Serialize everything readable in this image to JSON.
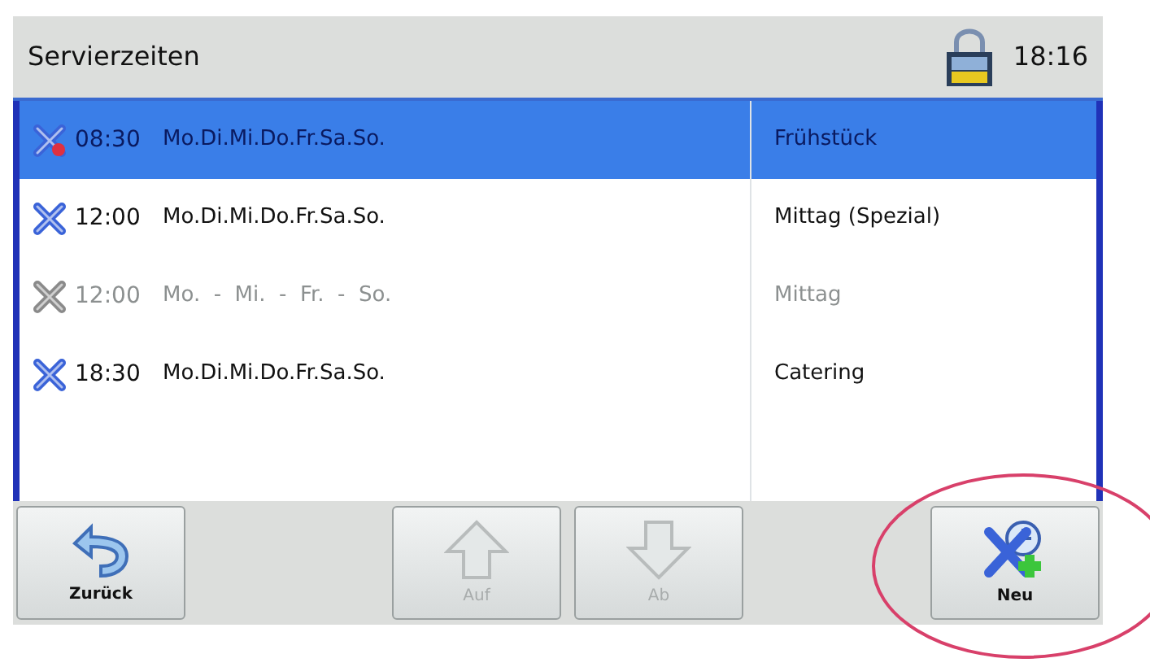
{
  "header": {
    "title": "Servierzeiten",
    "time": "18:16"
  },
  "rows": [
    {
      "time": "08:30",
      "days": "Mo.Di.Mi.Do.Fr.Sa.So.",
      "name": "Frühstück",
      "selected": true,
      "disabled": false,
      "flagged": true
    },
    {
      "time": "12:00",
      "days": "Mo.Di.Mi.Do.Fr.Sa.So.",
      "name": "Mittag (Spezial)",
      "selected": false,
      "disabled": false,
      "flagged": false
    },
    {
      "time": "12:00",
      "days": "Mo.  -  Mi.  -  Fr.  -  So.",
      "name": "Mittag",
      "selected": false,
      "disabled": true,
      "flagged": false
    },
    {
      "time": "18:30",
      "days": "Mo.Di.Mi.Do.Fr.Sa.So.",
      "name": "Catering",
      "selected": false,
      "disabled": false,
      "flagged": false
    }
  ],
  "buttons": [
    {
      "kind": "back",
      "label": "Zurück",
      "disabled": false
    },
    {
      "kind": "up",
      "label": "Auf",
      "disabled": true
    },
    {
      "kind": "down",
      "label": "Ab",
      "disabled": true
    },
    {
      "kind": "new",
      "label": "Neu",
      "disabled": false,
      "highlighted": true
    }
  ]
}
